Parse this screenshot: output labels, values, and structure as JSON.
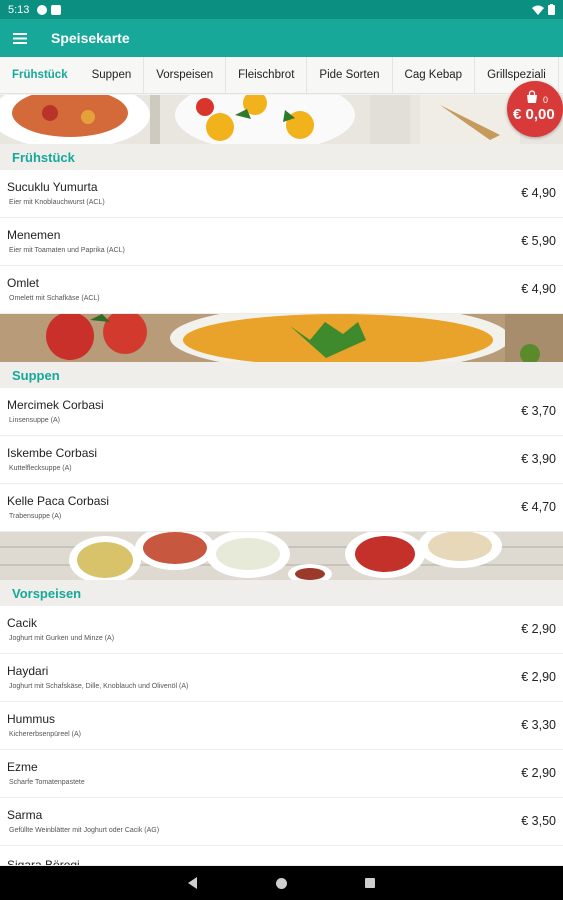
{
  "status": {
    "time": "5:13"
  },
  "appbar": {
    "title": "Speisekarte"
  },
  "tabs": [
    "Frühstück",
    "Suppen",
    "Vorspeisen",
    "Fleischbrot",
    "Pide Sorten",
    "Cag Kebap",
    "Grillspeziali"
  ],
  "cart": {
    "count": "0",
    "total": "€ 0,00"
  },
  "sections": [
    {
      "title": "Frühstück",
      "items": [
        {
          "name": "Sucuklu Yumurta",
          "desc": "Eier mit Knoblauchwurst (ACL)",
          "price": "€ 4,90"
        },
        {
          "name": "Menemen",
          "desc": "Eier mit Toamaten und Paprika  (ACL)",
          "price": "€ 5,90"
        },
        {
          "name": "Omlet",
          "desc": "Omelett mit Schafkäse (ACL)",
          "price": "€ 4,90"
        }
      ]
    },
    {
      "title": "Suppen",
      "items": [
        {
          "name": "Mercimek Corbasi",
          "desc": "Linsensuppe (A)",
          "price": "€ 3,70"
        },
        {
          "name": "Iskembe Corbasi",
          "desc": "Kuttelflecksuppe (A)",
          "price": "€ 3,90"
        },
        {
          "name": "Kelle Paca Corbasi",
          "desc": "Trabensuppe (A)",
          "price": "€ 4,70"
        }
      ]
    },
    {
      "title": "Vorspeisen",
      "items": [
        {
          "name": "Cacik",
          "desc": "Joghurt mit Gurken und Minze (A)",
          "price": "€ 2,90"
        },
        {
          "name": "Haydari",
          "desc": "Joghurt mit Schafskäse, Dille, Knoblauch und Olivenöl (A)",
          "price": "€ 2,90"
        },
        {
          "name": "Hummus",
          "desc": "Kichererbsenpüreel (A)",
          "price": "€ 3,30"
        },
        {
          "name": "Ezme",
          "desc": "Scharfe Tomatenpastete",
          "price": "€ 2,90"
        },
        {
          "name": "Sarma",
          "desc": "Gefüllte Weinblätter mit Joghurt oder Cacik (AG)",
          "price": "€ 3,50"
        },
        {
          "name": "Sigara Böregi",
          "desc": "",
          "price": ""
        }
      ]
    }
  ]
}
